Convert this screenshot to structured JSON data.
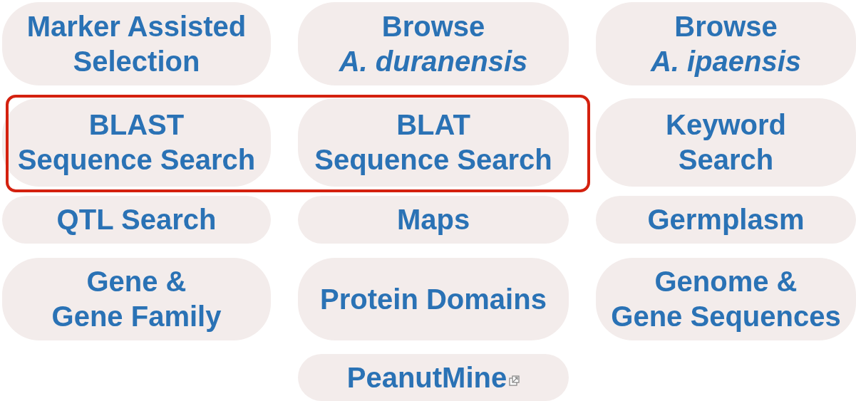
{
  "rows": [
    {
      "buttons": [
        {
          "lines": [
            "Marker Assisted",
            "Selection"
          ],
          "highlighted": false,
          "external": false
        },
        {
          "lines": [
            "Browse",
            "*A. duranensis*"
          ],
          "highlighted": false,
          "external": false
        },
        {
          "lines": [
            "Browse",
            "*A. ipaensis*"
          ],
          "highlighted": false,
          "external": false
        }
      ]
    },
    {
      "buttons": [
        {
          "lines": [
            "BLAST",
            "Sequence Search"
          ],
          "highlighted": true,
          "external": false
        },
        {
          "lines": [
            "BLAT",
            "Sequence Search"
          ],
          "highlighted": true,
          "external": false
        },
        {
          "lines": [
            "Keyword",
            "Search"
          ],
          "highlighted": false,
          "external": false
        }
      ]
    },
    {
      "buttons": [
        {
          "lines": [
            "QTL Search"
          ],
          "highlighted": false,
          "external": false
        },
        {
          "lines": [
            "Maps"
          ],
          "highlighted": false,
          "external": false
        },
        {
          "lines": [
            "Germplasm"
          ],
          "highlighted": false,
          "external": false
        }
      ]
    },
    {
      "buttons": [
        {
          "lines": [
            "Gene &",
            "Gene Family"
          ],
          "highlighted": false,
          "external": false
        },
        {
          "lines": [
            "Protein Domains"
          ],
          "highlighted": false,
          "external": false
        },
        {
          "lines": [
            "Genome &",
            "Gene Sequences"
          ],
          "highlighted": false,
          "external": false
        }
      ]
    },
    {
      "buttons": [
        {
          "lines": [
            "PeanutMine"
          ],
          "highlighted": false,
          "external": true
        }
      ]
    }
  ]
}
